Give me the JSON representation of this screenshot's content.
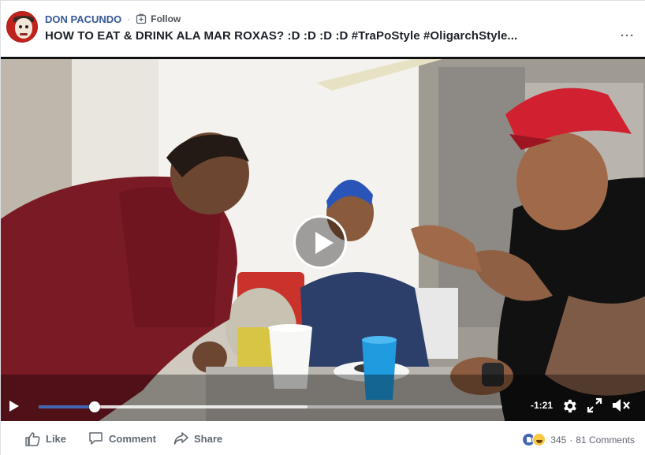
{
  "post": {
    "author": "DON PACUNDO",
    "separator": "·",
    "follow_label": "Follow",
    "title": "HOW TO EAT & DRINK ALA MAR ROXAS? :D :D :D :D #TraPoStyle #OligarchStyle...",
    "more_label": "···"
  },
  "video": {
    "time_remaining": "-1:21",
    "progress": 0.12,
    "buffered": 0.58,
    "icons": {
      "play": "play-icon",
      "settings": "gear-icon",
      "fullscreen": "expand-icon",
      "volume": "mute-icon"
    }
  },
  "actions": {
    "like_label": "Like",
    "comment_label": "Comment",
    "share_label": "Share"
  },
  "stats": {
    "reactions_count": "345",
    "separator": "·",
    "comments_label": "81 Comments"
  },
  "colors": {
    "author_link": "#365899",
    "progress": "#4267b2",
    "like_reaction": "#4267b2",
    "haha_reaction": "#f7c944"
  }
}
